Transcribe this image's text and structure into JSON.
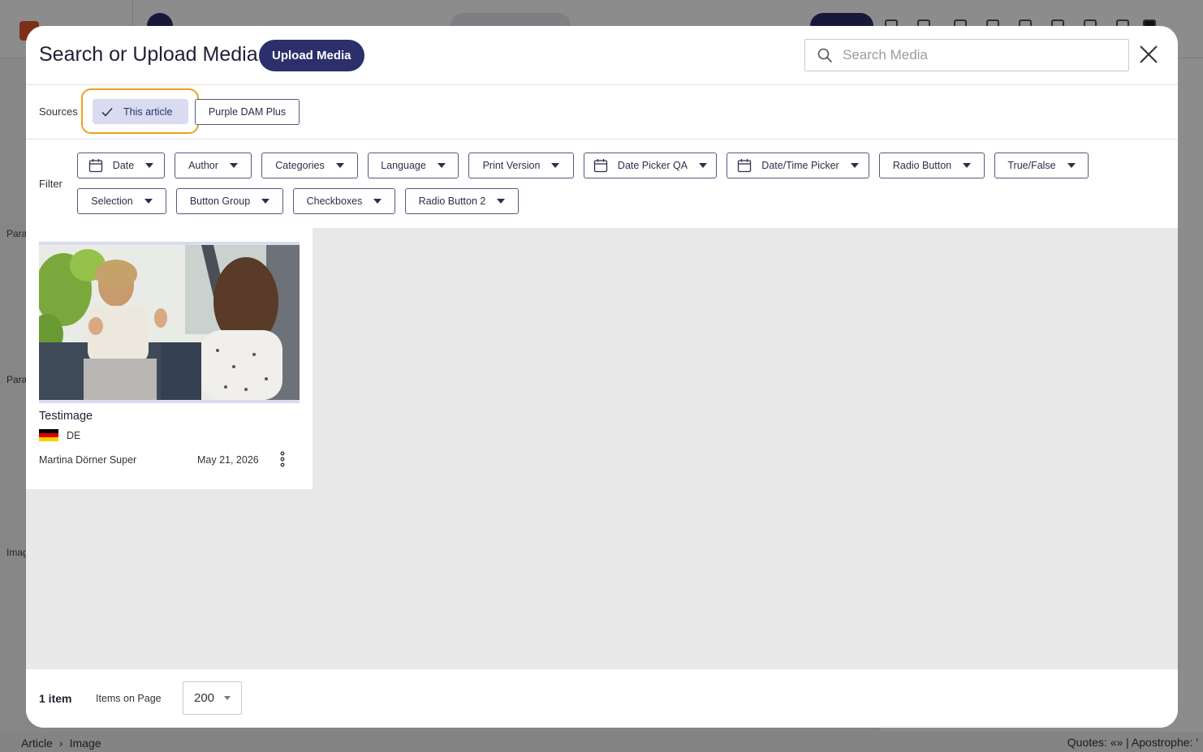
{
  "background": {
    "labels": [
      "Para",
      "Para",
      "Imag"
    ],
    "breadcrumb": [
      "Article",
      "Image"
    ],
    "status_text": "Quotes: «» | Apostrophe: '"
  },
  "modal": {
    "title": "Search or Upload Media",
    "upload_label": "Upload Media",
    "search_placeholder": "Search Media",
    "search_value": ""
  },
  "sources": {
    "label": "Sources",
    "items": [
      {
        "label": "This article",
        "selected": true
      },
      {
        "label": "Purple DAM Plus",
        "selected": false
      }
    ]
  },
  "filters": {
    "label": "Filter",
    "items": [
      {
        "label": "Date",
        "icon": "calendar-icon"
      },
      {
        "label": "Author"
      },
      {
        "label": "Categories"
      },
      {
        "label": "Language"
      },
      {
        "label": "Print Version"
      },
      {
        "label": "Date Picker QA",
        "icon": "calendar-icon"
      },
      {
        "label": "Date/Time Picker",
        "icon": "calendar-icon"
      },
      {
        "label": "Radio Button"
      },
      {
        "label": "True/False"
      },
      {
        "label": "Selection"
      },
      {
        "label": "Button Group"
      },
      {
        "label": "Checkboxes"
      },
      {
        "label": "Radio Button 2"
      }
    ]
  },
  "media": [
    {
      "title": "Testimage",
      "language": "DE",
      "author": "Martina Dörner Super",
      "date": "May 21, 2026"
    }
  ],
  "footer": {
    "count": "1 item",
    "items_on_page_label": "Items on Page",
    "items_on_page_value": "200"
  },
  "colors": {
    "accent": "#2c2f6b",
    "highlight": "#e8a317",
    "chip_selected": "#d9dcf0",
    "grid_bg": "#e8e8e8"
  }
}
